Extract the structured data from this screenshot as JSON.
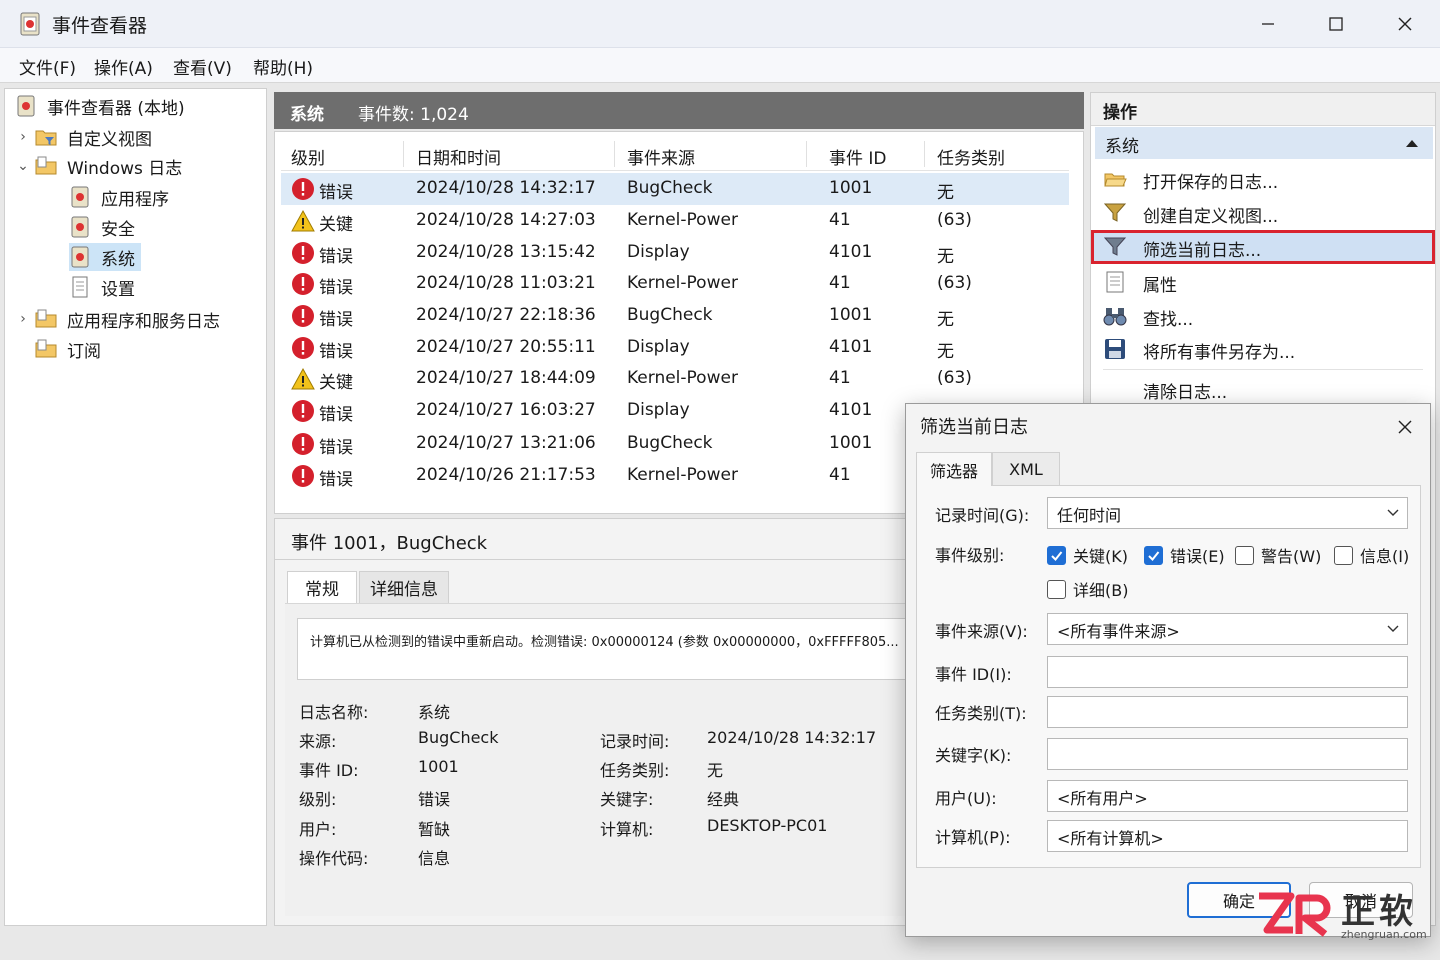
{
  "window": {
    "title": "事件查看器"
  },
  "menu": [
    "文件(F)",
    "操作(A)",
    "查看(V)",
    "帮助(H)"
  ],
  "tree": {
    "root": "事件查看器 (本地)",
    "custom_views": "自定义视图",
    "windows_logs": "Windows 日志",
    "application": "应用程序",
    "security": "安全",
    "system": "系统",
    "setup": "设置",
    "apps_services": "应用程序和服务日志",
    "subscriptions": "订阅"
  },
  "list": {
    "log_name": "系统",
    "count_label": "事件数: 1,024",
    "columns": [
      "级别",
      "日期和时间",
      "事件来源",
      "事件 ID",
      "任务类别"
    ],
    "rows": [
      {
        "level": "错误",
        "type": "error",
        "datetime": "2024/10/28 14:32:17",
        "source": "BugCheck",
        "id": "1001",
        "category": "无"
      },
      {
        "level": "关键",
        "type": "critical",
        "datetime": "2024/10/28 14:27:03",
        "source": "Kernel-Power",
        "id": "41",
        "category": "(63)"
      },
      {
        "level": "错误",
        "type": "error",
        "datetime": "2024/10/28 13:15:42",
        "source": "Display",
        "id": "4101",
        "category": "无"
      },
      {
        "level": "错误",
        "type": "error",
        "datetime": "2024/10/28 11:03:21",
        "source": "Kernel-Power",
        "id": "41",
        "category": "(63)"
      },
      {
        "level": "错误",
        "type": "error",
        "datetime": "2024/10/27 22:18:36",
        "source": "BugCheck",
        "id": "1001",
        "category": "无"
      },
      {
        "level": "错误",
        "type": "error",
        "datetime": "2024/10/27 20:55:11",
        "source": "Display",
        "id": "4101",
        "category": "无"
      },
      {
        "level": "关键",
        "type": "critical",
        "datetime": "2024/10/27 18:44:09",
        "source": "Kernel-Power",
        "id": "41",
        "category": "(63)"
      },
      {
        "level": "错误",
        "type": "error",
        "datetime": "2024/10/27 16:03:27",
        "source": "Display",
        "id": "4101",
        "category": ""
      },
      {
        "level": "错误",
        "type": "error",
        "datetime": "2024/10/27 13:21:06",
        "source": "BugCheck",
        "id": "1001",
        "category": ""
      },
      {
        "level": "错误",
        "type": "error",
        "datetime": "2024/10/26 21:17:53",
        "source": "Kernel-Power",
        "id": "41",
        "category": ""
      }
    ]
  },
  "detail": {
    "title": "事件 1001，BugCheck",
    "tabs": [
      "常规",
      "详细信息"
    ],
    "description": "计算机已从检测到的错误中重新启动。检测错误: 0x00000124 (参数 0x00000000，0xFFFFF805...",
    "fields": {
      "log_name_label": "日志名称:",
      "log_name": "系统",
      "source_label": "来源:",
      "source": "BugCheck",
      "event_id_label": "事件 ID:",
      "event_id": "1001",
      "level_label": "级别:",
      "level": "错误",
      "user_label": "用户:",
      "user": "暂缺",
      "opcode_label": "操作代码:",
      "opcode": "信息",
      "logged_label": "记录时间:",
      "logged": "2024/10/28 14:32:17",
      "category_label": "任务类别:",
      "category": "无",
      "keywords_label": "关键字:",
      "keywords": "经典",
      "computer_label": "计算机:",
      "computer": "DESKTOP-PC01"
    }
  },
  "actions": {
    "header": "操作",
    "section": "系统",
    "items": [
      "打开保存的日志...",
      "创建自定义视图...",
      "筛选当前日志...",
      "属性",
      "查找...",
      "将所有事件另存为...",
      "清除日志..."
    ]
  },
  "dialog": {
    "title": "筛选当前日志",
    "tabs": [
      "筛选器",
      "XML"
    ],
    "logged_label": "记录时间(G):",
    "logged_value": "任何时间",
    "level_label": "事件级别:",
    "levels": [
      {
        "label": "关键(K)",
        "checked": true
      },
      {
        "label": "错误(E)",
        "checked": true
      },
      {
        "label": "警告(W)",
        "checked": false
      },
      {
        "label": "信息(I)",
        "checked": false
      },
      {
        "label": "详细(B)",
        "checked": false
      }
    ],
    "source_label": "事件来源(V):",
    "source_value": "<所有事件来源>",
    "id_label": "事件 ID(I):",
    "category_label": "任务类别(T):",
    "keywords_label": "关键字(K):",
    "user_label": "用户(U):",
    "user_value": "<所有用户>",
    "computer_label": "计算机(P):",
    "computer_value": "<所有计算机>",
    "ok": "确定",
    "cancel": "取消"
  },
  "watermark": {
    "brand": "正软",
    "url": "zhengruan.com"
  }
}
